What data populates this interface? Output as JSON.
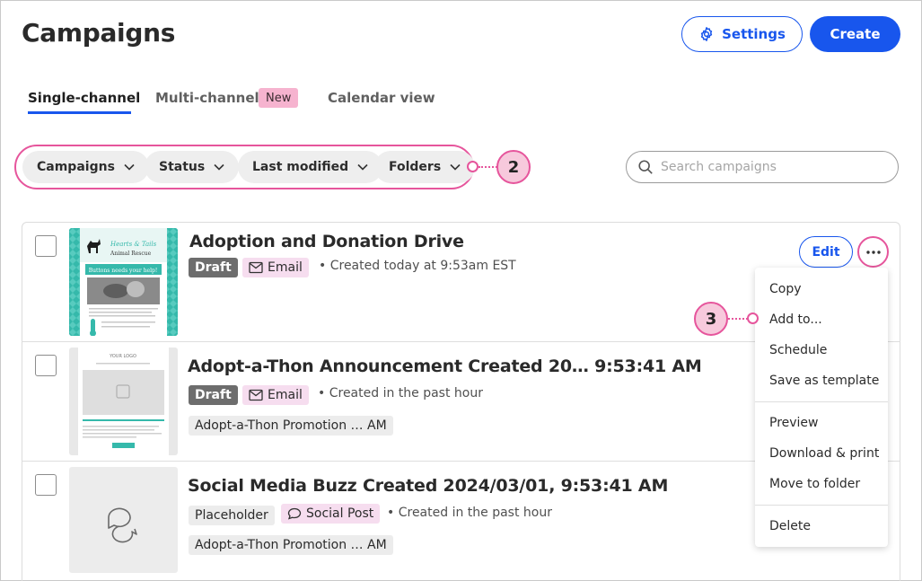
{
  "page": {
    "title": "Campaigns"
  },
  "header": {
    "settings_label": "Settings",
    "create_label": "Create"
  },
  "tabs": [
    {
      "label": "Single-channel",
      "active": true
    },
    {
      "label": "Multi-channel",
      "badge": "New"
    },
    {
      "label": "Calendar view"
    }
  ],
  "filters": [
    {
      "label": "Campaigns"
    },
    {
      "label": "Status"
    },
    {
      "label": "Last modified"
    },
    {
      "label": "Folders"
    }
  ],
  "search": {
    "placeholder": "Search campaigns",
    "value": ""
  },
  "callouts": [
    "2",
    "3"
  ],
  "campaigns": [
    {
      "title": "Adoption and Donation Drive",
      "status": "Draft",
      "channel": "Email",
      "meta": "Created today at 9:53am EST",
      "thumbnail": {
        "brand": "Hearts & Tails",
        "subtitle": "Animal Rescue",
        "headline": "Buttons needs your help!"
      }
    },
    {
      "title": "Adopt-a-Thon Announcement Created 20…  9:53:41 AM",
      "status": "Draft",
      "channel": "Email",
      "meta": "Created in the past hour",
      "folder": "Adopt-a-Thon Promotion …  AM",
      "thumbnail": {
        "logo": "YOUR LOGO"
      }
    },
    {
      "title": "Social Media Buzz Created 2024/03/01, 9:53:41 AM",
      "status": "Placeholder",
      "channel": "Social Post",
      "meta": "Created in the past hour",
      "folder": "Adopt-a-Thon Promotion …  AM"
    }
  ],
  "row_actions": {
    "edit_label": "Edit"
  },
  "more_menu": {
    "groups": [
      [
        "Copy",
        "Add to...",
        "Schedule",
        "Save as template"
      ],
      [
        "Preview",
        "Download & print",
        "Move to folder"
      ],
      [
        "Delete"
      ]
    ]
  },
  "colors": {
    "primary": "#1856ed",
    "callout": "#e6559c",
    "callout_fill": "#f7c9dc",
    "draft_tag": "#6d6d6d",
    "channel_tag": "#f6ddef",
    "thumbnail_teal": "#35b9ab"
  }
}
